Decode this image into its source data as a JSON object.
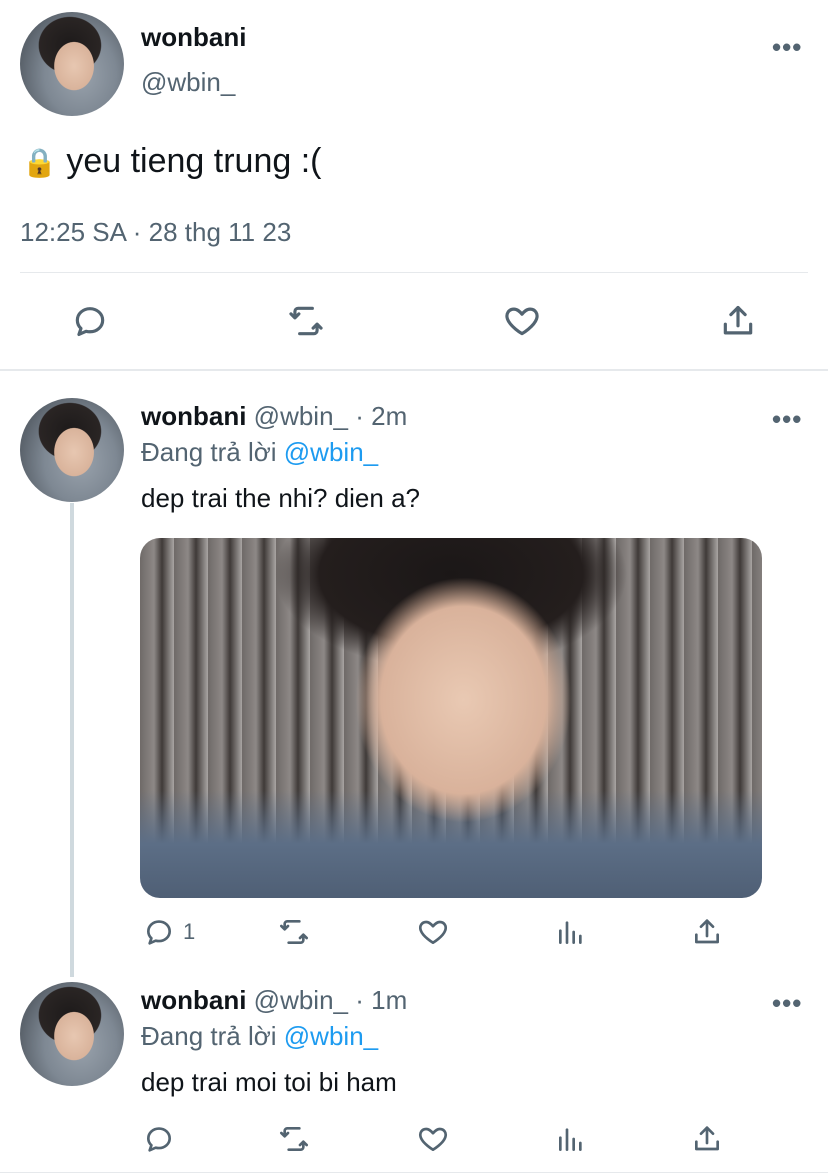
{
  "main_tweet": {
    "display_name": "wonbani",
    "handle": "@wbin_",
    "lock_emoji": "🔒",
    "text": "yeu tieng trung :(",
    "timestamp": "12:25 SA · 28 thg 11 23",
    "more_label": "•••"
  },
  "replies": [
    {
      "display_name": "wonbani",
      "meta": "@wbin_ · 2m",
      "replying_prefix": "Đang trả lời ",
      "replying_to": "@wbin_",
      "text": "dep trai the nhi? dien a?",
      "reply_count": "1",
      "more_label": "•••",
      "has_photo": true
    },
    {
      "display_name": "wonbani",
      "meta": "@wbin_ · 1m",
      "replying_prefix": "Đang trả lời ",
      "replying_to": "@wbin_",
      "text": "dep trai moi toi bi ham",
      "reply_count": "",
      "more_label": "•••",
      "has_photo": false
    }
  ],
  "colors": {
    "text_primary": "#0f1419",
    "text_secondary": "#536471",
    "link": "#1d9bf0",
    "divider": "#e6e9ec"
  },
  "icons": {
    "reply": "reply-icon",
    "retweet": "retweet-icon",
    "like": "heart-icon",
    "views": "views-icon",
    "share": "share-icon",
    "more": "more-icon"
  }
}
